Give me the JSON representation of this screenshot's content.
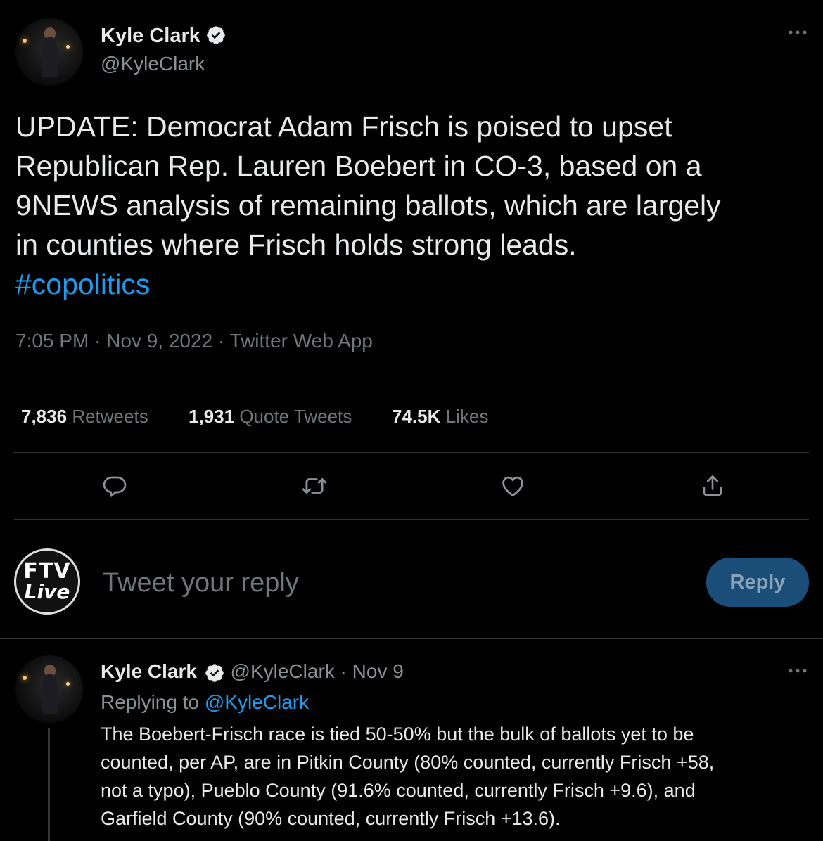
{
  "main_tweet": {
    "author": {
      "name": "Kyle Clark",
      "handle": "@KyleClark",
      "verified": true
    },
    "text": "UPDATE: Democrat Adam Frisch is poised to upset Republican Rep. Lauren Boebert in CO-3, based on a 9NEWS analysis of remaining ballots, which are largely in counties where Frisch holds strong leads.",
    "text_lines": [
      "UPDATE: Democrat Adam Frisch is poised to upset",
      "Republican Rep. Lauren Boebert in CO-3, based on a",
      "9NEWS analysis of remaining ballots, which are largely",
      "in counties where Frisch holds strong leads."
    ],
    "hashtag": "#copolitics",
    "meta": "7:05 PM · Nov 9, 2022 · Twitter Web App",
    "stats": {
      "retweets_count": "7,836",
      "retweets_label": "Retweets",
      "quotes_count": "1,931",
      "quotes_label": "Quote Tweets",
      "likes_count": "74.5K",
      "likes_label": "Likes"
    },
    "more_icon": "more-horizontal-icon"
  },
  "actions": [
    "reply-icon",
    "retweet-icon",
    "like-icon",
    "share-icon"
  ],
  "composer": {
    "avatar_text_top": "FTV",
    "avatar_text_bottom": "Live",
    "placeholder": "Tweet your reply",
    "button_label": "Reply"
  },
  "reply_tweet": {
    "author": {
      "name": "Kyle Clark",
      "handle": "@KyleClark",
      "verified": true
    },
    "date": "· Nov 9",
    "replying_prefix": "Replying to",
    "replying_to": "@KyleClark",
    "text_lines": [
      "The Boebert-Frisch race is tied 50-50% but the bulk of ballots yet to be",
      "counted, per AP, are in Pitkin County (80% counted, currently Frisch +58,",
      "not a typo), Pueblo County (91.6% counted, currently Frisch +9.6), and",
      "Garfield County (90% counted, currently Frisch +13.6)."
    ]
  },
  "colors": {
    "background": "#000000",
    "text": "#e7e9ea",
    "muted": "#71767b",
    "accent": "#1d9bf0",
    "divider": "#2f3336",
    "reply_button": "#1a4d78"
  }
}
